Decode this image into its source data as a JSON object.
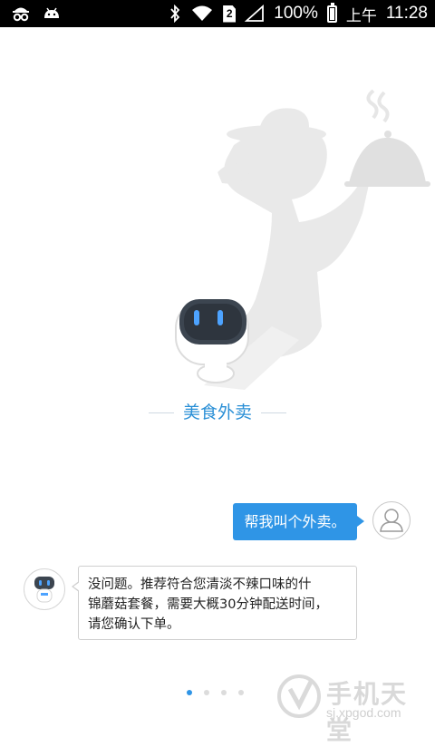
{
  "status_bar": {
    "battery_percent": "100%",
    "battery_level": 1.0,
    "am_pm": "上午",
    "time": "11:28",
    "icons": [
      "incognito-icon",
      "android-icon",
      "bluetooth-icon",
      "wifi-icon",
      "sim-icon",
      "signal-icon",
      "battery-icon"
    ]
  },
  "hero": {
    "title": "美食外卖"
  },
  "chat": {
    "user_message": "帮我叫个外卖。",
    "bot_lines": [
      "没问题。推荐符合您清淡不辣口味的什",
      "锦蘑菇套餐，需要大概30分钟配送时间，",
      "请您确认下单。"
    ]
  },
  "pager": {
    "total": 4,
    "current": 1
  },
  "watermark": {
    "brand": "手机天堂",
    "url": "sj.xpgod.com"
  },
  "colors": {
    "accent": "#2f95e6",
    "title": "#2a8fd6"
  }
}
